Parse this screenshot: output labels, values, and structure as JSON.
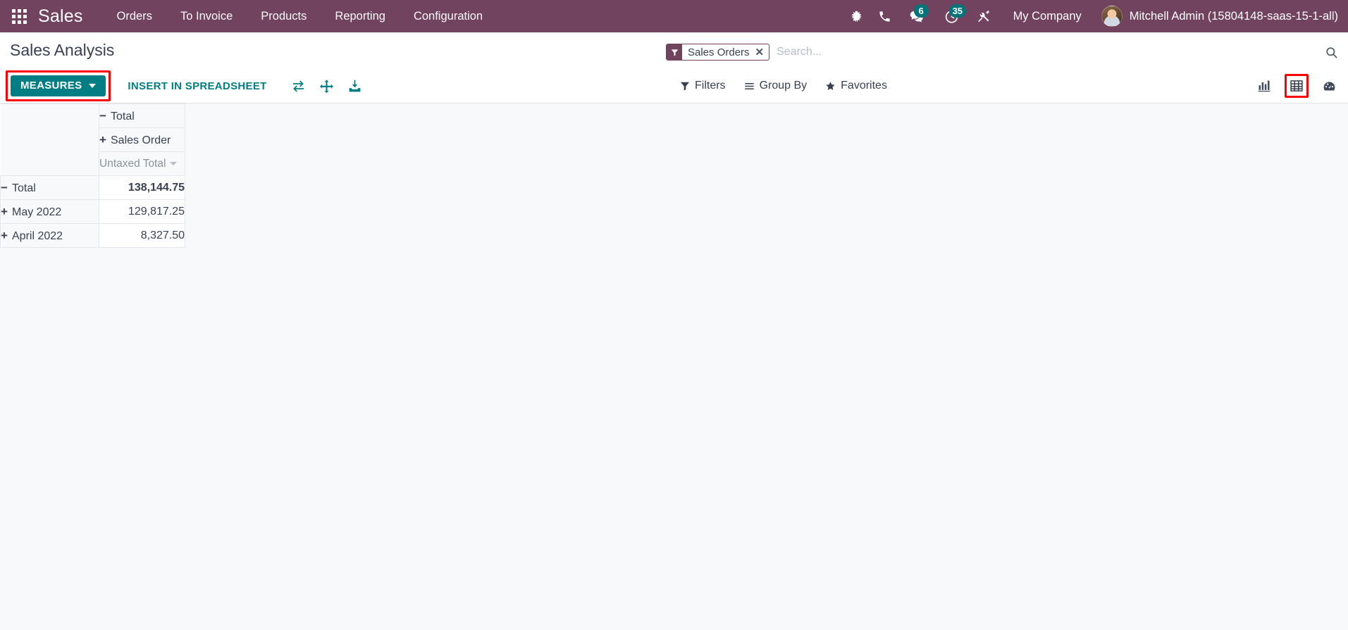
{
  "navbar": {
    "apps_icon": "apps-grid-icon",
    "brand": "Sales",
    "menu": [
      {
        "label": "Orders"
      },
      {
        "label": "To Invoice"
      },
      {
        "label": "Products"
      },
      {
        "label": "Reporting"
      },
      {
        "label": "Configuration"
      }
    ],
    "icons": [
      {
        "name": "bug-icon",
        "badge": null
      },
      {
        "name": "phone-icon",
        "badge": null
      },
      {
        "name": "messages-icon",
        "badge": "6"
      },
      {
        "name": "activities-clock-icon",
        "badge": "35"
      },
      {
        "name": "tools-icon",
        "badge": null
      }
    ],
    "company": "My Company",
    "user_name": "Mitchell Admin (15804148-saas-15-1-all)",
    "colors": {
      "background": "#71435f",
      "badge": "#00747a"
    }
  },
  "control_panel": {
    "page_title": "Sales Analysis",
    "search": {
      "facet_label": "Sales Orders",
      "facet_icon": "filter-funnel-icon",
      "facet_remove": "✕",
      "placeholder": "Search...",
      "value": "",
      "search_icon": "magnifier-icon"
    },
    "measures_button": {
      "label": "Measures",
      "icon": "chevron-down-icon",
      "highlighted": true,
      "color": "#017e84",
      "highlight_color": "#ff0000"
    },
    "insert_spreadsheet_button": "Insert in Spreadsheet",
    "toolbar_icons": [
      {
        "name": "flip-axis-icon"
      },
      {
        "name": "expand-all-icon"
      },
      {
        "name": "download-xlsx-icon"
      }
    ],
    "dropdowns": [
      {
        "label": "Filters",
        "icon": "filter-funnel-icon"
      },
      {
        "label": "Group By",
        "icon": "hamburger-lines-icon"
      },
      {
        "label": "Favorites",
        "icon": "star-icon"
      }
    ],
    "view_switcher": [
      {
        "name": "graph-view-icon",
        "label": "Graph",
        "active": false
      },
      {
        "name": "pivot-view-icon",
        "label": "Pivot",
        "active": true
      },
      {
        "name": "dashboard-view-icon",
        "label": "Dashboard",
        "active": false
      }
    ]
  },
  "pivot": {
    "column_headers": {
      "total": {
        "toggle": "−",
        "label": "Total"
      },
      "group": {
        "toggle": "+",
        "label": "Sales Order"
      },
      "measure": {
        "label": "Untaxed Total",
        "caret": "chevron-down-icon"
      }
    },
    "rows": [
      {
        "toggle": "−",
        "label": "Total",
        "value": "138,144.75",
        "indent": 0,
        "bold": true
      },
      {
        "toggle": "+",
        "label": "May 2022",
        "value": "129,817.25",
        "indent": 1,
        "bold": false
      },
      {
        "toggle": "+",
        "label": "April 2022",
        "value": "8,327.50",
        "indent": 1,
        "bold": false
      }
    ]
  },
  "chart_data": {
    "type": "table",
    "title": "Sales Analysis",
    "measure": "Untaxed Total",
    "column_group": "Total",
    "categories": [
      "Total",
      "May 2022",
      "April 2022"
    ],
    "values": [
      138144.75,
      129817.25,
      8327.5
    ]
  }
}
